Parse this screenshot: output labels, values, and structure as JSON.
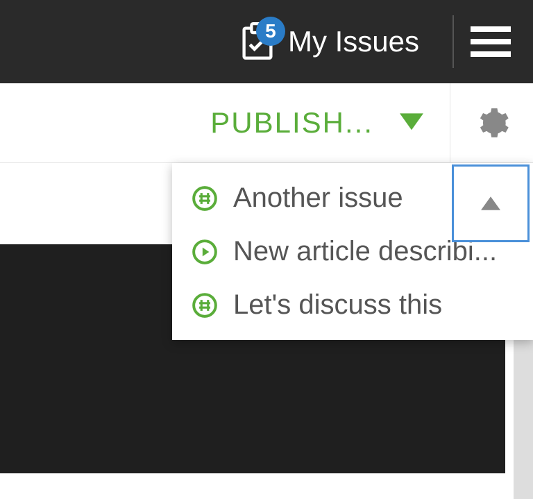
{
  "topbar": {
    "my_issues": {
      "label": "My Issues",
      "badge": "5"
    }
  },
  "actionbar": {
    "publish_label": "PUBLISH..."
  },
  "dropdown": {
    "items": [
      {
        "icon": "hash",
        "label": "Another issue"
      },
      {
        "icon": "play",
        "label": "New article describi..."
      },
      {
        "icon": "hash",
        "label": "Let's discuss this"
      }
    ]
  }
}
